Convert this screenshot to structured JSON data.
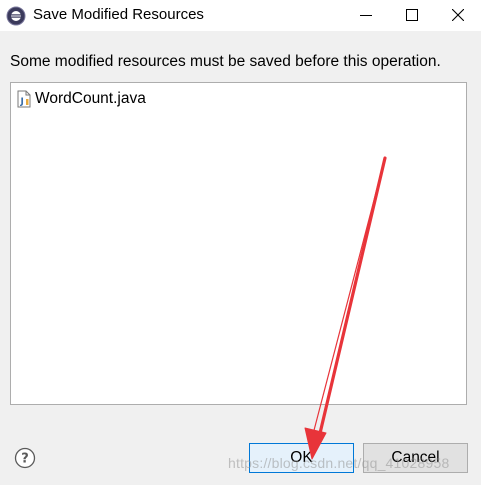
{
  "window": {
    "title": "Save Modified Resources",
    "minimize_icon": "minimize-icon",
    "maximize_icon": "maximize-icon",
    "close_icon": "close-icon"
  },
  "dialog": {
    "message": "Some modified resources must be saved before this operation.",
    "resources": [
      {
        "label": "WordCount.java",
        "icon": "java-file-icon"
      }
    ]
  },
  "buttons": {
    "ok_label": "OK",
    "cancel_label": "Cancel",
    "help_icon": "help-icon"
  },
  "overlay": {
    "watermark": "https://blog.csdn.net/qq_41028958",
    "annotation_arrow_color": "#e8343a"
  },
  "colors": {
    "ok_border": "#0078d7",
    "ok_background": "#e5f1fb"
  }
}
